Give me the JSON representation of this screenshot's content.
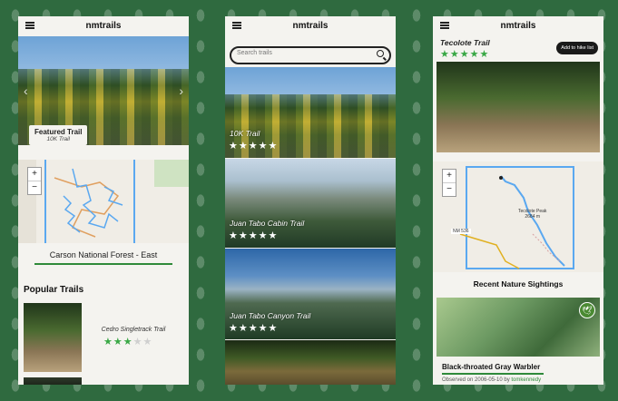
{
  "brand": "nmtrails",
  "screen1": {
    "featured_label": "Featured Trail",
    "featured_name": "10K Trail",
    "forest_name": "Carson National Forest - East",
    "popular_heading": "Popular Trails",
    "popular_trail_name": "Cedro Singletrack Trail",
    "popular_rating": 3,
    "map_zoom_in": "+",
    "map_zoom_out": "−",
    "arrow_left": "‹",
    "arrow_right": "›"
  },
  "screen2": {
    "search_placeholder": "Search trails",
    "trails": [
      {
        "name": "10K Trail",
        "rating": 5
      },
      {
        "name": "Juan Tabo Cabin Trail",
        "rating": 5
      },
      {
        "name": "Juan Tabo Canyon Trail",
        "rating": 5
      }
    ]
  },
  "screen3": {
    "trail_name": "Tecolote Trail",
    "rating": 5,
    "add_button": "Add to hike list",
    "map_label_peak": "Tecolote Peak",
    "map_label_elev": "2684 m",
    "map_label_road": "NM 536",
    "map_zoom_in": "+",
    "map_zoom_out": "−",
    "sightings_heading": "Recent Nature Sightings",
    "bird_name": "Black-throated Gray Warbler",
    "observed_prefix": "Observed on 2006-05-10 by ",
    "observer": "tomkennedy",
    "badge_icon": "bird-icon"
  },
  "colors": {
    "background": "#2f6a3f",
    "accent_green": "#39a845",
    "map_trail": "#5aa8f0"
  }
}
